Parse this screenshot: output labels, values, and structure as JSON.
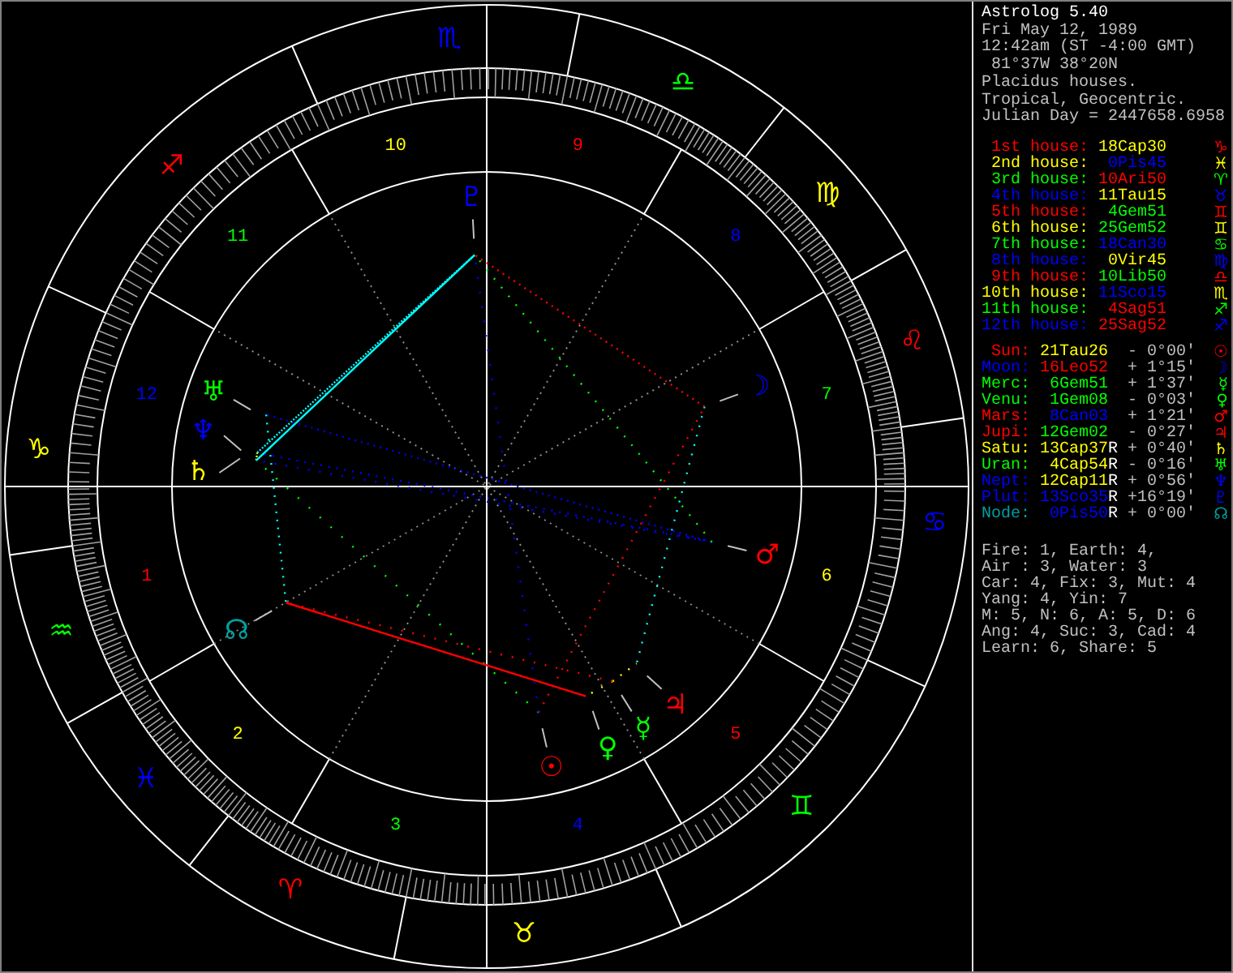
{
  "chart": {
    "signs": [
      {
        "glyph": "♈",
        "color": "#ff0000"
      },
      {
        "glyph": "♉",
        "color": "#ffff00"
      },
      {
        "glyph": "♊",
        "color": "#00ff00"
      },
      {
        "glyph": "♋",
        "color": "#0000ff"
      },
      {
        "glyph": "♌",
        "color": "#ff0000"
      },
      {
        "glyph": "♍",
        "color": "#ffff00"
      },
      {
        "glyph": "♎",
        "color": "#00ff00"
      },
      {
        "glyph": "♏",
        "color": "#0000ff"
      },
      {
        "glyph": "♐",
        "color": "#ff0000"
      },
      {
        "glyph": "♑",
        "color": "#ffff00"
      },
      {
        "glyph": "♒",
        "color": "#00ff00"
      },
      {
        "glyph": "♓",
        "color": "#0000ff"
      }
    ],
    "house_numbers": [
      {
        "label": "1",
        "color": "#ff0000"
      },
      {
        "label": "2",
        "color": "#ffff00"
      },
      {
        "label": "3",
        "color": "#00ff00"
      },
      {
        "label": "4",
        "color": "#0000ff"
      },
      {
        "label": "5",
        "color": "#ff0000"
      },
      {
        "label": "6",
        "color": "#ffff00"
      },
      {
        "label": "7",
        "color": "#00ff00"
      },
      {
        "label": "8",
        "color": "#0000ff"
      },
      {
        "label": "9",
        "color": "#ff0000"
      },
      {
        "label": "10",
        "color": "#ffff00"
      },
      {
        "label": "11",
        "color": "#00ff00"
      },
      {
        "label": "12",
        "color": "#0000ff"
      }
    ],
    "planets": [
      {
        "glyph": "☉",
        "color": "#ff0000"
      },
      {
        "glyph": "☽",
        "color": "#0000ff"
      },
      {
        "glyph": "☿",
        "color": "#00ff00"
      },
      {
        "glyph": "♀",
        "color": "#00ff00"
      },
      {
        "glyph": "♂",
        "color": "#ff0000"
      },
      {
        "glyph": "♃",
        "color": "#ff0000"
      },
      {
        "glyph": "♄",
        "color": "#ffff00"
      },
      {
        "glyph": "♅",
        "color": "#00ff00"
      },
      {
        "glyph": "♆",
        "color": "#0000ff"
      },
      {
        "glyph": "♇",
        "color": "#0000ff"
      },
      {
        "glyph": "☊",
        "color": "#00a0a0"
      }
    ]
  },
  "info": {
    "title": "Astrolog 5.40",
    "lines": [
      "Fri May 12, 1989",
      "12:42am (ST -4:00 GMT)",
      " 81°37W 38°20N",
      "Placidus houses.",
      "Tropical, Geocentric.",
      "Julian Day = 2447658.6958"
    ]
  },
  "houses": [
    {
      "label": "1st house:",
      "color": "#ff0000",
      "position": {
        "text": "18Cap30",
        "color": "#ffff00"
      },
      "glyph": "♑"
    },
    {
      "label": "2nd house:",
      "color": "#ffff00",
      "position": {
        "text": "0Pis45",
        "color": "#0000ff"
      },
      "glyph": "♓"
    },
    {
      "label": "3rd house:",
      "color": "#00ff00",
      "position": {
        "text": "10Ari50",
        "color": "#ff0000"
      },
      "glyph": "♈"
    },
    {
      "label": "4th house:",
      "color": "#0000ff",
      "position": {
        "text": "11Tau15",
        "color": "#ffff00"
      },
      "glyph": "♉"
    },
    {
      "label": "5th house:",
      "color": "#ff0000",
      "position": {
        "text": "4Gem51",
        "color": "#00ff00"
      },
      "glyph": "♊"
    },
    {
      "label": "6th house:",
      "color": "#ffff00",
      "position": {
        "text": "25Gem52",
        "color": "#00ff00"
      },
      "glyph": "♊"
    },
    {
      "label": "7th house:",
      "color": "#00ff00",
      "position": {
        "text": "18Can30",
        "color": "#0000ff"
      },
      "glyph": "♋"
    },
    {
      "label": "8th house:",
      "color": "#0000ff",
      "position": {
        "text": "0Vir45",
        "color": "#ffff00"
      },
      "glyph": "♍"
    },
    {
      "label": "9th house:",
      "color": "#ff0000",
      "position": {
        "text": "10Lib50",
        "color": "#00ff00"
      },
      "glyph": "♎"
    },
    {
      "label": "10th house:",
      "color": "#ffff00",
      "position": {
        "text": "11Sco15",
        "color": "#0000ff"
      },
      "glyph": "♏"
    },
    {
      "label": "11th house:",
      "color": "#00ff00",
      "position": {
        "text": "4Sag51",
        "color": "#ff0000"
      },
      "glyph": "♐"
    },
    {
      "label": "12th house:",
      "color": "#0000ff",
      "position": {
        "text": "25Sag52",
        "color": "#ff0000"
      },
      "glyph": "♐"
    }
  ],
  "planets": [
    {
      "label": "Sun:",
      "color": "#ff0000",
      "position": {
        "text": "21Tau26",
        "color": "#ffff00"
      },
      "latitude": "- 0°00'",
      "glyph": "☉"
    },
    {
      "label": "Moon:",
      "color": "#0000ff",
      "position": {
        "text": "16Leo52",
        "color": "#ff0000"
      },
      "latitude": "+ 1°15'",
      "glyph": "☽"
    },
    {
      "label": "Merc:",
      "color": "#00ff00",
      "position": {
        "text": "6Gem51",
        "color": "#00ff00"
      },
      "latitude": "+ 1°37'",
      "glyph": "☿"
    },
    {
      "label": "Venu:",
      "color": "#00ff00",
      "position": {
        "text": "1Gem08",
        "color": "#00ff00"
      },
      "latitude": "- 0°03'",
      "glyph": "♀"
    },
    {
      "label": "Mars:",
      "color": "#ff0000",
      "position": {
        "text": "8Can03",
        "color": "#0000ff"
      },
      "latitude": "+ 1°21'",
      "glyph": "♂"
    },
    {
      "label": "Jupi:",
      "color": "#ff0000",
      "position": {
        "text": "12Gem02",
        "color": "#00ff00"
      },
      "latitude": "- 0°27'",
      "glyph": "♃"
    },
    {
      "label": "Satu:",
      "color": "#ffff00",
      "position": {
        "text": "13Cap37",
        "color": "#ffff00"
      },
      "flag": "R",
      "latitude": "+ 0°40'",
      "glyph": "♄"
    },
    {
      "label": "Uran:",
      "color": "#00ff00",
      "position": {
        "text": "4Cap54",
        "color": "#ffff00"
      },
      "flag": "R",
      "latitude": "- 0°16'",
      "glyph": "♅"
    },
    {
      "label": "Nept:",
      "color": "#0000ff",
      "position": {
        "text": "12Cap11",
        "color": "#ffff00"
      },
      "flag": "R",
      "latitude": "+ 0°56'",
      "glyph": "♆"
    },
    {
      "label": "Plut:",
      "color": "#0000ff",
      "position": {
        "text": "13Sco35",
        "color": "#0000ff"
      },
      "flag": "R",
      "latitude": "+16°19'",
      "glyph": "♇"
    },
    {
      "label": "Node:",
      "color": "#00a0a0",
      "position": {
        "text": "0Pis50",
        "color": "#0000ff"
      },
      "flag": "R",
      "latitude": "+ 0°00'",
      "glyph": "☊"
    }
  ],
  "stats": [
    "Fire: 1, Earth: 4,",
    "Air : 3, Water: 3",
    "Car: 4, Fix: 3, Mut: 4",
    "Yang: 4, Yin: 7",
    "M: 5, N: 6, A: 5, D: 6",
    "Ang: 4, Suc: 3, Cad: 4",
    "Learn: 6, Share: 5"
  ]
}
